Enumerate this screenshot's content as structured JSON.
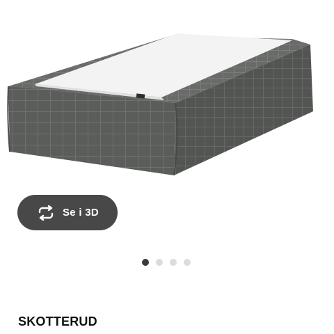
{
  "product": {
    "name": "SKOTTERUD",
    "image_alt_icon": "bed-base-product-image"
  },
  "view_3d": {
    "label": "Se i 3D",
    "icon": "rotate-3d-icon"
  },
  "carousel": {
    "dot_count": 4,
    "active_index": 0
  },
  "colors": {
    "button_bg": "#484848",
    "dot_active": "#3a3a3a",
    "dot_inactive": "#dcdcdc",
    "fabric": "#5b5e5b",
    "mattress_top": "#f4f4f4"
  }
}
